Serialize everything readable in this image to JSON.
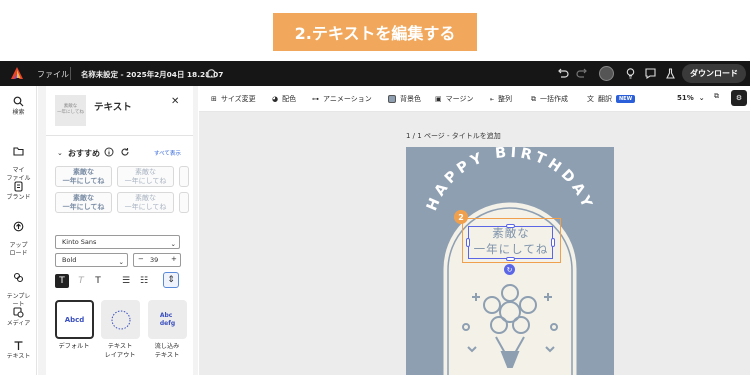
{
  "banner": "2.テキストを編集する",
  "topbar": {
    "file_menu": "ファイル",
    "document_title": "名称未設定 - 2025年2月04日 18.21.07",
    "download_label": "ダウンロード"
  },
  "rail": [
    {
      "label": "検索",
      "icon": "search-icon"
    },
    {
      "label": "マイ\nファイル",
      "icon": "folder-icon"
    },
    {
      "label": "ブランド",
      "icon": "brand-icon"
    },
    {
      "label": "アップ\nロード",
      "icon": "upload-icon"
    },
    {
      "label": "テンプレ\nート",
      "icon": "template-icon"
    },
    {
      "label": "メディア",
      "icon": "media-icon"
    },
    {
      "label": "テキスト",
      "icon": "text-icon"
    }
  ],
  "panel": {
    "thumb_text": "素敵な\n一年にしてね",
    "title": "テキスト",
    "close_icon": "close-icon",
    "recommended_label": "おすすめ",
    "see_all": "すべて表示",
    "samples": [
      "素敵な\n一年にしてね",
      "素敵な\n一年にしてね",
      "素敵な\n一年にしてね",
      "素敵な\n一年にしてね"
    ],
    "font_family": "Kinto Sans",
    "font_weight": "Bold",
    "font_size": "39",
    "styles": [
      {
        "preview": "Abcd",
        "label": "デフォルト"
      },
      {
        "preview": "",
        "label": "テキスト\nレイアウト"
      },
      {
        "preview": "Abc\ndefg",
        "label": "流し込み\nテキスト"
      }
    ]
  },
  "toolbar": {
    "resize": "サイズ変更",
    "color": "配色",
    "animation": "アニメーション",
    "bg_color": "背景色",
    "margin": "マージン",
    "align": "整列",
    "bulk_create": "一括作成",
    "translate": "翻訳",
    "new_badge": "NEW",
    "zoom": "51%"
  },
  "canvas": {
    "page_info": "1 / 1 ページ - タイトルを追加",
    "arc_text": "HAPPY BIRTHDAY",
    "main_text": "素敵な\n一年にしてね",
    "step_number": "2"
  },
  "colors": {
    "banner": "#f1a85c",
    "card_bg": "#8e9fb2",
    "selection": "#5b66e6",
    "accent_orange": "#f0a04c"
  }
}
